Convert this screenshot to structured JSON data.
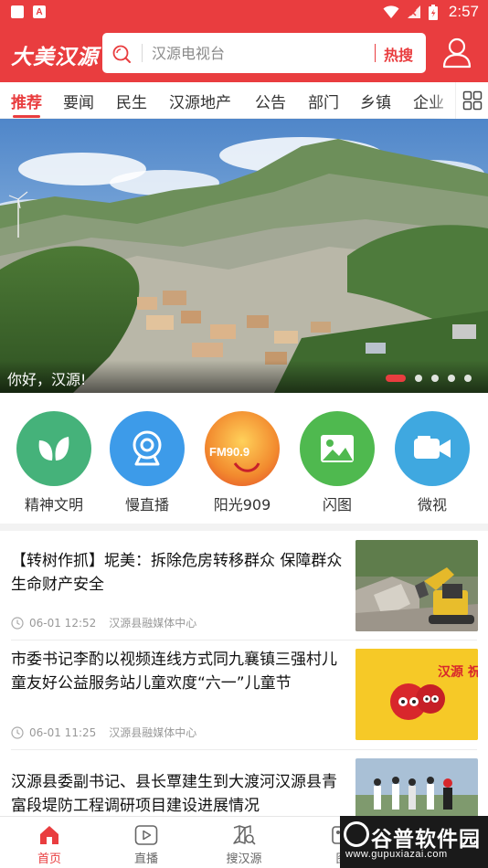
{
  "status_bar": {
    "time": "2:57",
    "app_badge": "A"
  },
  "header": {
    "logo": "大美汉源",
    "search_placeholder": "汉源电视台",
    "hot_label": "热搜"
  },
  "tabs": [
    {
      "label": "推荐"
    },
    {
      "label": "要闻"
    },
    {
      "label": "民生"
    },
    {
      "label": "汉源地产"
    },
    {
      "label": "公告"
    },
    {
      "label": "部门"
    },
    {
      "label": "乡镇"
    },
    {
      "label": "企业"
    }
  ],
  "banner": {
    "caption": "你好，汉源!",
    "slide_count": 5,
    "active_slide": 1
  },
  "quick_links": [
    {
      "label": "精神文明",
      "icon": "leaf-icon",
      "color": "#45b27a"
    },
    {
      "label": "慢直播",
      "icon": "webcam-icon",
      "color": "#3d9be9"
    },
    {
      "label": "阳光909",
      "icon": "fm-909-logo",
      "logo_text": "FM90.9",
      "color": "#ef5a2a"
    },
    {
      "label": "闪图",
      "icon": "image-icon",
      "color": "#4fb94f"
    },
    {
      "label": "微视",
      "icon": "video-camera-icon",
      "color": "#3fa8e0"
    }
  ],
  "news": [
    {
      "title": "【转树作抓】坭美：拆除危房转移群众 保障群众生命财产安全",
      "time": "06-01 12:52",
      "source": "汉源县融媒体中心"
    },
    {
      "title": "市委书记李酌以视频连线方式同九襄镇三强村儿童友好公益服务站儿童欢度“六一”儿童节",
      "time": "06-01 11:25",
      "source": "汉源县融媒体中心"
    },
    {
      "title": "汉源县委副书记、县长覃建生到大渡河汉源县青富段堤防工程调研项目建设进展情况",
      "time": "",
      "source": ""
    }
  ],
  "thumb2_text": "汉源 祝你",
  "bottom_nav": [
    {
      "label": "首页",
      "icon": "home-icon",
      "active": true
    },
    {
      "label": "直播",
      "icon": "play-icon",
      "active": false
    },
    {
      "label": "搜汉源",
      "icon": "map-search-icon",
      "active": false
    },
    {
      "label": "图",
      "icon": "image-icon",
      "active": false
    }
  ],
  "watermark": {
    "title": "谷普软件园",
    "url": "www.gupuxiazai.com"
  },
  "colors": {
    "brand_red": "#e93d3f"
  }
}
